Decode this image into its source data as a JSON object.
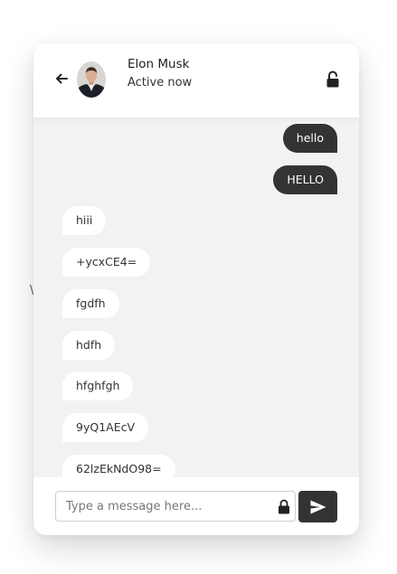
{
  "header": {
    "contact_name": "Elon Musk",
    "status": "Active now",
    "back_icon": "arrow-left-icon",
    "lock_icon": "unlock-icon"
  },
  "messages": [
    {
      "direction": "out",
      "text": "hello"
    },
    {
      "direction": "out",
      "text": "HELLO"
    },
    {
      "direction": "in",
      "text": "hiii"
    },
    {
      "direction": "in",
      "text": "+ycxCE4="
    },
    {
      "direction": "in",
      "text": "fgdfh"
    },
    {
      "direction": "in",
      "text": "hdfh"
    },
    {
      "direction": "in",
      "text": "hfghfgh"
    },
    {
      "direction": "in",
      "text": "9yQ1AEcV"
    },
    {
      "direction": "in",
      "text": "62lzEkNdO98="
    }
  ],
  "footer": {
    "placeholder": "Type a message here...",
    "lock_icon": "lock-icon",
    "send_icon": "send-icon"
  },
  "background_text": "\\",
  "colors": {
    "outgoing_bubble": "#333333",
    "incoming_bubble": "#ffffff",
    "chat_background": "#f2f2f2"
  }
}
